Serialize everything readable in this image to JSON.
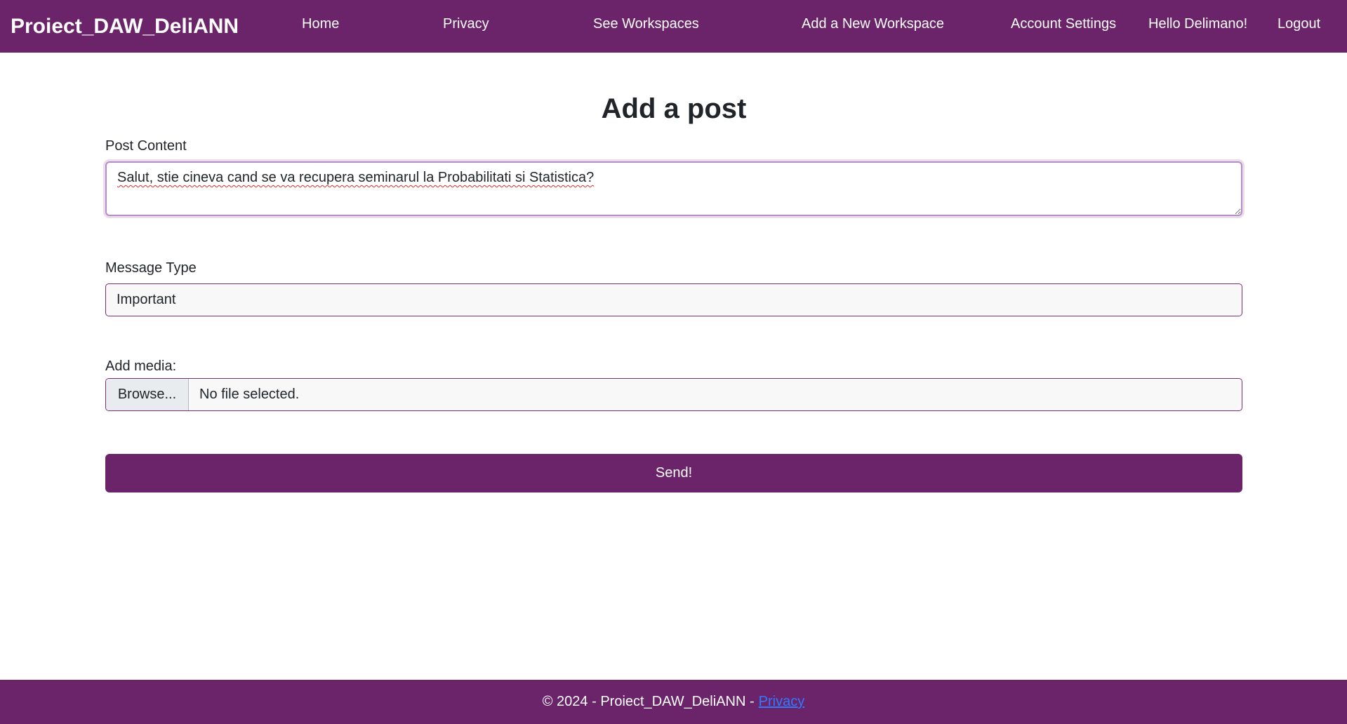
{
  "navbar": {
    "brand": "Proiect_DAW_DeliANN",
    "links": [
      {
        "label": "Home"
      },
      {
        "label": "Privacy"
      },
      {
        "label": "See Workspaces"
      },
      {
        "label": "Add a New Workspace"
      },
      {
        "label": "Account Settings"
      },
      {
        "label": "Hello Delimano!"
      },
      {
        "label": "Logout"
      }
    ]
  },
  "form": {
    "title": "Add a post",
    "content_label": "Post Content",
    "content_value": "Salut, stie cineva cand se va recupera seminarul la Probabilitati si Statistica?",
    "type_label": "Message Type",
    "type_value": "Important",
    "media_label": "Add media:",
    "browse_label": "Browse...",
    "file_status": "No file selected.",
    "submit_label": "Send!"
  },
  "footer": {
    "copyright": "© 2024 - Proiect_DAW_DeliANN -",
    "privacy_link": "Privacy"
  },
  "colors": {
    "brand_purple": "#6b2369",
    "link_blue": "#2f7bff"
  }
}
